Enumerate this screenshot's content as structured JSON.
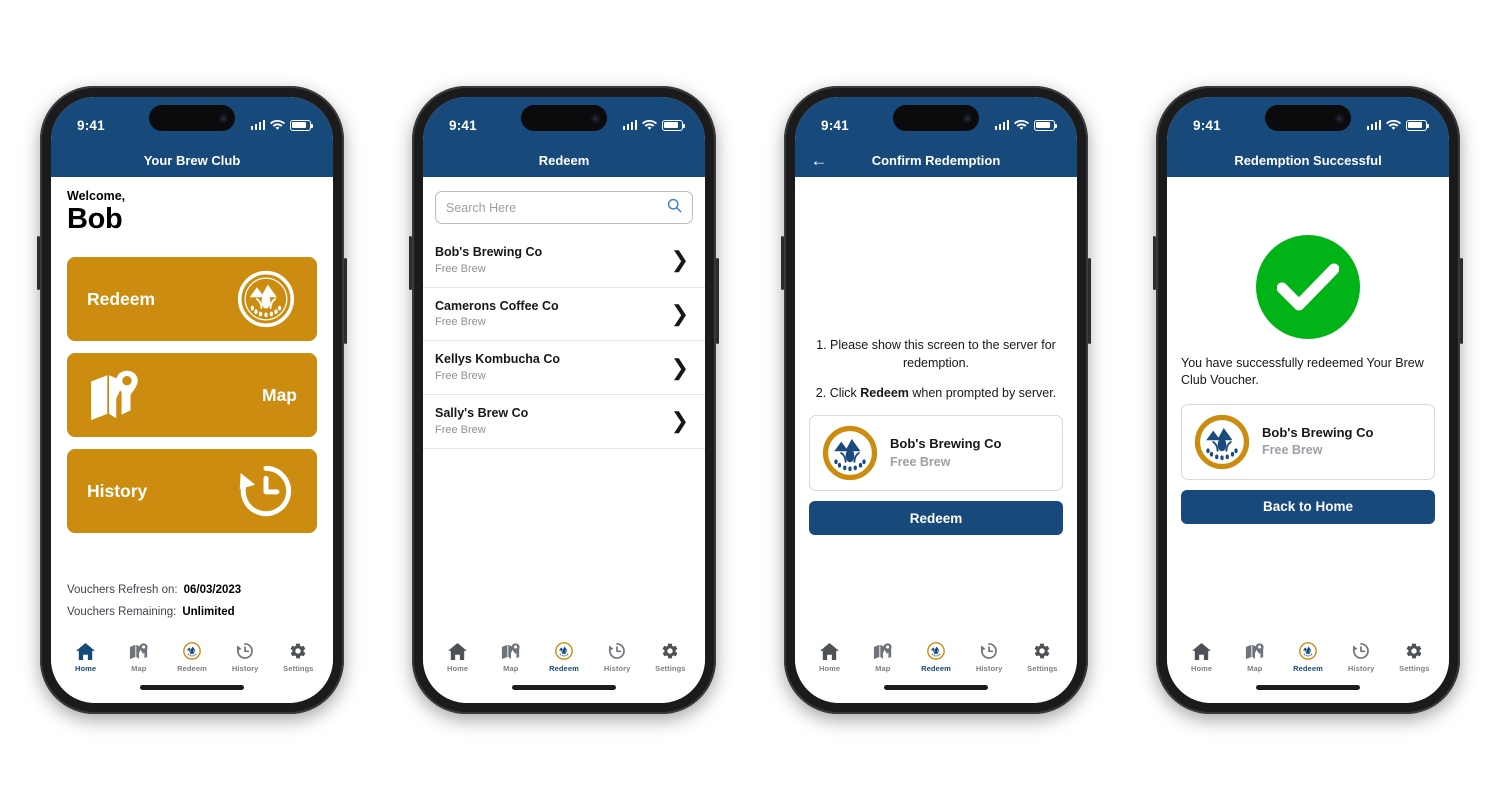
{
  "app": {
    "brand_blue": "#17497A",
    "brand_gold": "#CC8C10",
    "success_green": "#00B317"
  },
  "status_bar": {
    "time": "9:41",
    "signal_icon": "cellular-signal-icon",
    "wifi_icon": "wifi-icon",
    "battery_icon": "battery-icon"
  },
  "tab_bar": {
    "items": [
      {
        "label": "Home",
        "icon": "home-icon"
      },
      {
        "label": "Map",
        "icon": "map-icon"
      },
      {
        "label": "Redeem",
        "icon": "brew-club-badge-icon"
      },
      {
        "label": "History",
        "icon": "history-clock-icon"
      },
      {
        "label": "Settings",
        "icon": "gear-icon"
      }
    ]
  },
  "screens": [
    {
      "id": "home",
      "title": "Your Brew Club",
      "active_tab": "Home",
      "welcome_label": "Welcome,",
      "user_name": "Bob",
      "buttons": [
        {
          "label": "Redeem",
          "icon": "brew-club-badge-icon"
        },
        {
          "label": "Map",
          "icon": "map-location-icon"
        },
        {
          "label": "History",
          "icon": "history-clock-icon"
        }
      ],
      "info": [
        {
          "key": "Vouchers Refresh on:",
          "value": "06/03/2023"
        },
        {
          "key": "Vouchers Remaining:",
          "value": "Unlimited"
        }
      ]
    },
    {
      "id": "redeem-list",
      "title": "Redeem",
      "active_tab": "Redeem",
      "search": {
        "placeholder": "Search Here",
        "icon": "search-icon"
      },
      "businesses": [
        {
          "name": "Bob's Brewing Co",
          "offer": "Free Brew"
        },
        {
          "name": "Camerons Coffee Co",
          "offer": "Free Brew"
        },
        {
          "name": "Kellys Kombucha Co",
          "offer": "Free Brew"
        },
        {
          "name": "Sally's Brew Co",
          "offer": "Free Brew"
        }
      ],
      "chevron_icon": "chevron-right-icon"
    },
    {
      "id": "confirm",
      "title": "Confirm Redemption",
      "active_tab": "Redeem",
      "back_icon": "back-arrow-icon",
      "steps": [
        {
          "prefix": "1. Please show this screen to the server for redemption.",
          "bold": "",
          "suffix": ""
        },
        {
          "prefix": "2. Click ",
          "bold": "Redeem",
          "suffix": " when prompted by server."
        }
      ],
      "merchant": {
        "name": "Bob's Brewing Co",
        "offer": "Free Brew",
        "logo": "brew-club-badge-icon"
      },
      "action_label": "Redeem"
    },
    {
      "id": "success",
      "title": "Redemption Successful",
      "active_tab": "Redeem",
      "check_icon": "success-check-icon",
      "message": "You have successfully redeemed Your Brew Club Voucher.",
      "merchant": {
        "name": "Bob's Brewing Co",
        "offer": "Free Brew",
        "logo": "brew-club-badge-icon"
      },
      "action_label": "Back to Home"
    }
  ]
}
